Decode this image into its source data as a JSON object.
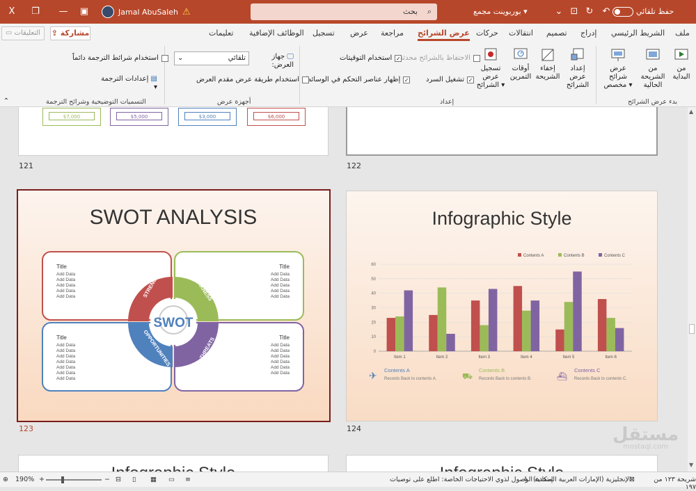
{
  "titlebar": {
    "close_glyph": "X",
    "user_name": "Jamal AbuSaleh",
    "search_placeholder": "بحث",
    "document_title": "بوربوينت مجمع ▾",
    "autosave_label": "حفظ تلقائي"
  },
  "tabs": [
    "ملف",
    "الشريط الرئيسي",
    "إدراج",
    "تصميم",
    "انتقالات",
    "حركات",
    "عرض الشرائح",
    "مراجعة",
    "عرض",
    "تسجيل",
    "الوظائف الإضافية",
    "تعليمات"
  ],
  "active_tab": "عرض الشرائح",
  "share_label": "مشاركة",
  "comments_label": "التعليقات",
  "ribbon": {
    "start_group": {
      "label": "بدء عرض الشرائح",
      "buttons": [
        "من البداية",
        "من الشريحة الحالية",
        "عرض شرائح مخصص ▾"
      ]
    },
    "setup_group": {
      "label": "إعداد",
      "buttons": [
        "إعداد عرض الشرائح",
        "إخفاء الشريحة",
        "أوقات التمرين",
        "تسجيل عرض الشرائح ▾"
      ],
      "checks": [
        {
          "label": "الاحتفاظ بالشرائح محدثة",
          "checked": false,
          "disabled": true
        },
        {
          "label": "استخدام التوقيتات",
          "checked": true,
          "disabled": false
        },
        {
          "label": "تشغيل السرد",
          "checked": true,
          "disabled": false
        },
        {
          "label": "إظهار عناصر التحكم في الوسائط",
          "checked": true,
          "disabled": false
        }
      ]
    },
    "monitors_group": {
      "label": "أجهزة عرض",
      "display_label": "جهاز العرض:",
      "display_value": "تلقائي",
      "presenter_view": "استخدام طريقة عرض مقدم العرض"
    },
    "captions_group": {
      "label": "التسميات التوضيحية وشرائح الترجمة",
      "always_use": "استخدام شرائط الترجمة دائماً",
      "settings": "إعدادات الترجمة ▾"
    }
  },
  "slides": {
    "s121_number": "121",
    "s121_values": [
      "$7,000",
      "$5,000",
      "$3,000",
      "$6,000"
    ],
    "s122_number": "122",
    "s123_number": "123",
    "s124_number": "124",
    "swot": {
      "title": "SWOT ANALYSIS",
      "center": "SWOT",
      "quadrants": [
        "STRENGTHS",
        "WEAKNESS",
        "OPPORTUNITIES",
        "THREATS"
      ],
      "box_title": "Title",
      "box_lines": [
        "Add Data",
        "Add Data",
        "Add Data",
        "Add Data",
        "Add Data",
        "Add Data",
        "Add Data"
      ],
      "colors": {
        "red": "#c0504d",
        "green": "#9bbb59",
        "blue": "#4f81bd",
        "purple": "#8064a2"
      }
    },
    "infographic": {
      "title": "Infographic Style",
      "legend_items": [
        {
          "name": "Contents A",
          "text": "Records Back to contents A."
        },
        {
          "name": "Contents B",
          "text": "Records Back to contents B."
        },
        {
          "name": "Contents C",
          "text": "Records Back to contents C."
        }
      ]
    },
    "next_titles": [
      "Infographic Style",
      "Infographic Style"
    ]
  },
  "chart_data": {
    "type": "bar",
    "title": "",
    "categories": [
      "Item 1",
      "Item 2",
      "Item 3",
      "Item 4",
      "Item 5",
      "Item 6"
    ],
    "series": [
      {
        "name": "Contents A",
        "color": "#c0504d",
        "values": [
          23,
          25,
          35,
          45,
          15,
          36
        ]
      },
      {
        "name": "Contents B",
        "color": "#9bbb59",
        "values": [
          24,
          44,
          18,
          28,
          34,
          23
        ]
      },
      {
        "name": "Contents C",
        "color": "#8064a2",
        "values": [
          42,
          12,
          43,
          35,
          55,
          16
        ]
      }
    ],
    "ylim": [
      0,
      60
    ],
    "yticks": [
      0,
      10,
      20,
      30,
      40,
      50,
      60
    ],
    "legend": "top",
    "grid": true
  },
  "statusbar": {
    "slide_counter": "شريحة ١٢٣ من ١٩٧",
    "language": "الإنجليزية (الإمارات العربية المتحدة)",
    "accessibility": "إمكانية الوصول لذوي الاحتياجات الخاصة: اطلع على توصيات",
    "zoom": "190%"
  },
  "watermark": {
    "main": "مستقل",
    "sub": "mostaql.com"
  }
}
